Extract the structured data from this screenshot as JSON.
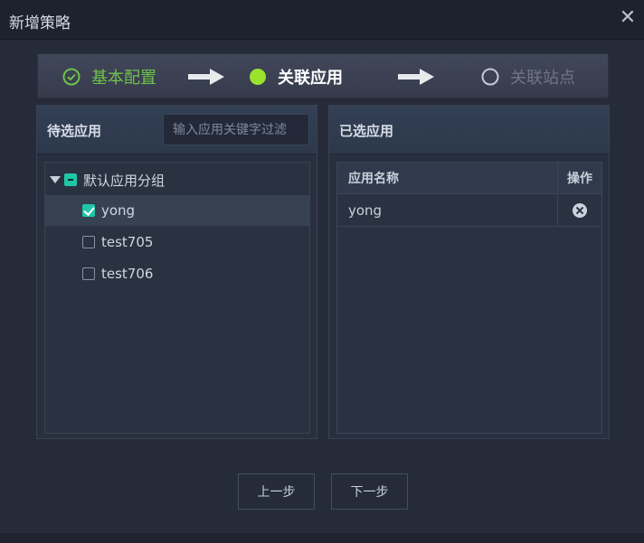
{
  "dialog": {
    "title": "新增策略",
    "close_symbol": "✕"
  },
  "steps": [
    {
      "label": "基本配置",
      "state": "done"
    },
    {
      "label": "关联应用",
      "state": "active"
    },
    {
      "label": "关联站点",
      "state": "pending"
    }
  ],
  "colors": {
    "done": "#6fc24a",
    "active": "#9be22d",
    "pending": "#6f7585",
    "checkbox": "#1fc7a8"
  },
  "left_panel": {
    "title": "待选应用",
    "filter_placeholder": "输入应用关键字过滤",
    "tree": {
      "group": {
        "label": "默认应用分组",
        "state": "partial"
      },
      "items": [
        {
          "label": "yong",
          "checked": true
        },
        {
          "label": "test705",
          "checked": false
        },
        {
          "label": "test706",
          "checked": false
        }
      ]
    }
  },
  "right_panel": {
    "title": "已选应用",
    "columns": [
      "应用名称",
      "操作"
    ],
    "rows": [
      {
        "name": "yong"
      }
    ]
  },
  "footer": {
    "prev_label": "上一步",
    "next_label": "下一步"
  }
}
